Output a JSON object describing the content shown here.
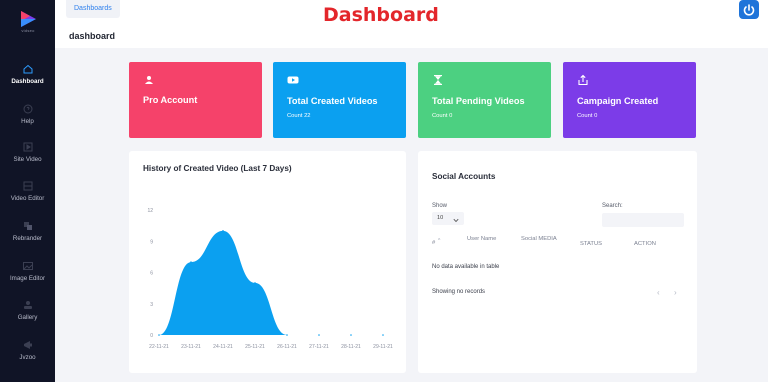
{
  "sidebar": {
    "logo_text": "vidseo",
    "items": [
      {
        "label": "Dashboard",
        "icon": "home-icon",
        "active": true
      },
      {
        "label": "Help",
        "icon": "help-icon",
        "active": false
      },
      {
        "label": "Site Video",
        "icon": "site-video-icon",
        "active": false
      },
      {
        "label": "Video Editor",
        "icon": "video-editor-icon",
        "active": false
      },
      {
        "label": "Rebrander",
        "icon": "rebrander-icon",
        "active": false
      },
      {
        "label": "Image Editor",
        "icon": "image-editor-icon",
        "active": false
      },
      {
        "label": "Gallery",
        "icon": "gallery-icon",
        "active": false
      },
      {
        "label": "Jvzoo",
        "icon": "megaphone-icon",
        "active": false
      }
    ]
  },
  "header": {
    "breadcrumb": "Dashboards",
    "overlay_title": "Dashboard",
    "page_title": "dashboard",
    "power_icon": "power-icon"
  },
  "cards": [
    {
      "title": "Pro Account",
      "sub": "",
      "icon": "user-icon",
      "color": "#f5426a"
    },
    {
      "title": "Total Created Videos",
      "sub": "Count 22",
      "icon": "youtube-icon",
      "color": "#0ba0f0"
    },
    {
      "title": "Total Pending Videos",
      "sub": "Count 0",
      "icon": "hourglass-icon",
      "color": "#4cd081"
    },
    {
      "title": "Campaign Created",
      "sub": "Count 0",
      "icon": "share-icon",
      "color": "#7c3ce8"
    }
  ],
  "chart_panel": {
    "title": "History of Created Video (Last 7 Days)"
  },
  "chart_data": {
    "type": "area",
    "categories": [
      "22-11-21",
      "23-11-21",
      "24-11-21",
      "25-11-21",
      "26-11-21",
      "27-11-21",
      "28-11-21",
      "29-11-21"
    ],
    "values": [
      0,
      7,
      10,
      5,
      0,
      0,
      0,
      0
    ],
    "yticks": [
      0,
      3,
      6,
      9,
      12
    ],
    "ylim": [
      0,
      12
    ],
    "color": "#0ba0f0",
    "title": "",
    "xlabel": "",
    "ylabel": ""
  },
  "social": {
    "title": "Social Accounts",
    "show_label": "Show",
    "show_value": "10",
    "search_label": "Search:",
    "search_value": "",
    "columns": [
      "#",
      "User Name",
      "Social MEDIA",
      "STATUS",
      "ACTION"
    ],
    "empty_text": "No data available in table",
    "showing_text": "Showing no records",
    "prev": "‹",
    "next": "›"
  }
}
